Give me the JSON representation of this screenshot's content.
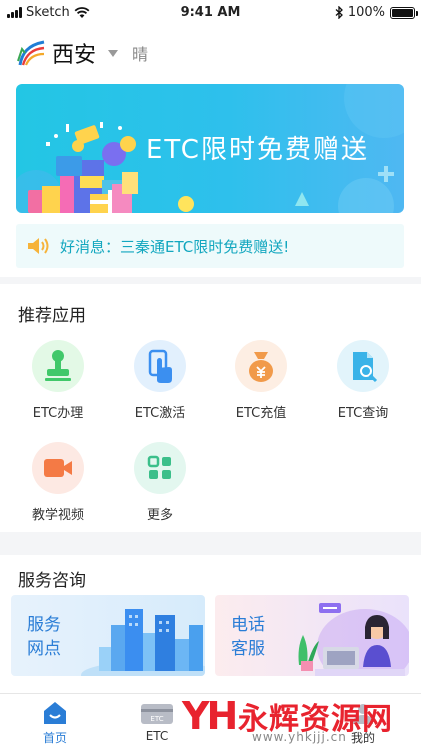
{
  "status_bar": {
    "carrier": "Sketch",
    "time": "9:41 AM",
    "battery": "100%",
    "battery_level": 1.0
  },
  "header": {
    "city": "西安",
    "weather": "晴"
  },
  "banner": {
    "title": "ETC限时免费赠送"
  },
  "notice": {
    "text": "好消息：三秦通ETC限时免费赠送!"
  },
  "recommended": {
    "title": "推荐应用",
    "apps": [
      {
        "label": "ETC办理",
        "icon": "stamp-icon",
        "bg": "#e3f9e6",
        "fg": "#41c86a"
      },
      {
        "label": "ETC激活",
        "icon": "tap-hand-icon",
        "bg": "#e2f0fd",
        "fg": "#3b8ff0"
      },
      {
        "label": "ETC充值",
        "icon": "money-bag-icon",
        "bg": "#fdeee3",
        "fg": "#f19a4a"
      },
      {
        "label": "ETC查询",
        "icon": "document-search-icon",
        "bg": "#e2f4fb",
        "fg": "#3ab3e8"
      },
      {
        "label": "教学视频",
        "icon": "video-camera-icon",
        "bg": "#fde9e3",
        "fg": "#f47a45"
      },
      {
        "label": "更多",
        "icon": "grid-icon",
        "bg": "#e3f7ef",
        "fg": "#3bbf8a"
      }
    ]
  },
  "service": {
    "title": "服务咨询",
    "outlets": {
      "line1": "服务",
      "line2": "网点"
    },
    "hotline": {
      "line1": "电话",
      "line2": "客服"
    }
  },
  "tabbar": {
    "tabs": [
      {
        "label": "首页",
        "icon": "home-icon",
        "active": true
      },
      {
        "label": "ETC",
        "icon": "etc-card-icon",
        "active": false
      },
      {
        "label": "我的",
        "icon": "profile-icon",
        "active": false
      }
    ]
  },
  "watermark": {
    "text": "永辉资源网",
    "url": "www.yhkjjj.cn",
    "logo": "YH"
  },
  "colors": {
    "accent": "#2a7dd6",
    "teal": "#13a7bf",
    "banner_from": "#23c6e4",
    "banner_to": "#4fb8f2"
  }
}
